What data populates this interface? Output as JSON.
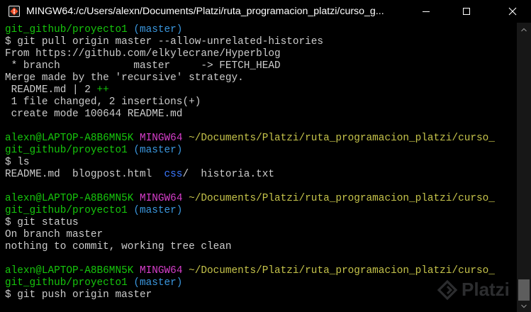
{
  "window": {
    "title": "MINGW64:/c/Users/alexn/Documents/Platzi/ruta_programacion_platzi/curso_g..."
  },
  "terminal": {
    "lines": [
      [
        {
          "text": "git_github/proyecto1 ",
          "color": "green"
        },
        {
          "text": "(master)",
          "color": "cyan"
        }
      ],
      [
        {
          "text": "$ git pull origin master --allow-unrelated-histories",
          "color": "white"
        }
      ],
      [
        {
          "text": "From https://github.com/elkylecrane/Hyperblog",
          "color": "white"
        }
      ],
      [
        {
          "text": " * branch            master     -> FETCH_HEAD",
          "color": "white"
        }
      ],
      [
        {
          "text": "Merge made by the 'recursive' strategy.",
          "color": "white"
        }
      ],
      [
        {
          "text": " README.md | 2 ",
          "color": "white"
        },
        {
          "text": "++",
          "color": "green"
        }
      ],
      [
        {
          "text": " 1 file changed, 2 insertions(+)",
          "color": "white"
        }
      ],
      [
        {
          "text": " create mode 100644 README.md",
          "color": "white"
        }
      ],
      [
        {
          "text": "",
          "color": "white"
        }
      ],
      [
        {
          "text": "alexn@LAPTOP-A8B6MN5K ",
          "color": "green"
        },
        {
          "text": "MINGW64 ",
          "color": "magenta"
        },
        {
          "text": "~/Documents/Platzi/ruta_programacion_platzi/curso_",
          "color": "yellow"
        }
      ],
      [
        {
          "text": "git_github/proyecto1 ",
          "color": "green"
        },
        {
          "text": "(master)",
          "color": "cyan"
        }
      ],
      [
        {
          "text": "$ ls",
          "color": "white"
        }
      ],
      [
        {
          "text": "README.md  blogpost.html  ",
          "color": "white"
        },
        {
          "text": "css",
          "color": "blue"
        },
        {
          "text": "/  historia.txt",
          "color": "white"
        }
      ],
      [
        {
          "text": "",
          "color": "white"
        }
      ],
      [
        {
          "text": "alexn@LAPTOP-A8B6MN5K ",
          "color": "green"
        },
        {
          "text": "MINGW64 ",
          "color": "magenta"
        },
        {
          "text": "~/Documents/Platzi/ruta_programacion_platzi/curso_",
          "color": "yellow"
        }
      ],
      [
        {
          "text": "git_github/proyecto1 ",
          "color": "green"
        },
        {
          "text": "(master)",
          "color": "cyan"
        }
      ],
      [
        {
          "text": "$ git status",
          "color": "white"
        }
      ],
      [
        {
          "text": "On branch master",
          "color": "white"
        }
      ],
      [
        {
          "text": "nothing to commit, working tree clean",
          "color": "white"
        }
      ],
      [
        {
          "text": "",
          "color": "white"
        }
      ],
      [
        {
          "text": "alexn@LAPTOP-A8B6MN5K ",
          "color": "green"
        },
        {
          "text": "MINGW64 ",
          "color": "magenta"
        },
        {
          "text": "~/Documents/Platzi/ruta_programacion_platzi/curso_",
          "color": "yellow"
        }
      ],
      [
        {
          "text": "git_github/proyecto1 ",
          "color": "green"
        },
        {
          "text": "(master)",
          "color": "cyan"
        }
      ],
      [
        {
          "text": "$ git push origin master",
          "color": "white"
        }
      ]
    ]
  },
  "watermark": {
    "text": "Platzi"
  },
  "colors": {
    "background": "#000000",
    "text": "#cccccc",
    "green": "#16c60c",
    "magenta": "#d73ecb",
    "yellow": "#c5c34a",
    "cyan": "#3a96dd",
    "blue": "#3b78ff"
  },
  "icons": {
    "app": "git-bash-icon",
    "minimize": "minimize-icon",
    "maximize": "maximize-icon",
    "close": "close-icon",
    "scroll_up": "chevron-up-icon",
    "scroll_down": "chevron-down-icon",
    "watermark": "platzi-logo-icon"
  }
}
